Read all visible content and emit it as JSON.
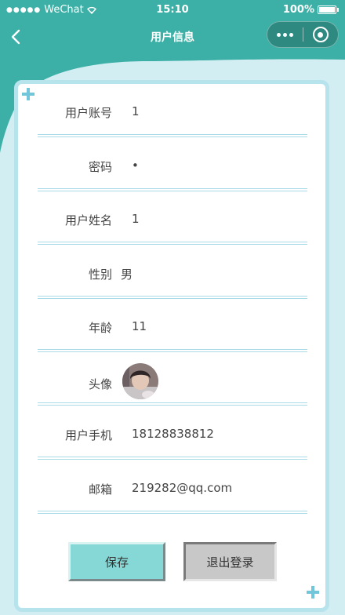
{
  "status_bar": {
    "carrier": "WeChat",
    "time": "15:10",
    "battery": "100%"
  },
  "nav": {
    "title": "用户信息"
  },
  "fields": [
    {
      "label": "用户账号",
      "value": "1"
    },
    {
      "label": "密码",
      "value": "•"
    },
    {
      "label": "用户姓名",
      "value": "1"
    },
    {
      "label": "性别",
      "value": "男"
    },
    {
      "label": "年龄",
      "value": "11"
    },
    {
      "label": "头像",
      "value": ""
    },
    {
      "label": "用户手机",
      "value": "18128838812"
    },
    {
      "label": "邮箱",
      "value": "219282@qq.com"
    }
  ],
  "buttons": {
    "save": "保存",
    "logout": "退出登录"
  },
  "colors": {
    "header": "#3cb0a6",
    "card_border": "#b7e3ec",
    "save_button": "#86d8d6",
    "logout_button": "#c8c8c8"
  }
}
